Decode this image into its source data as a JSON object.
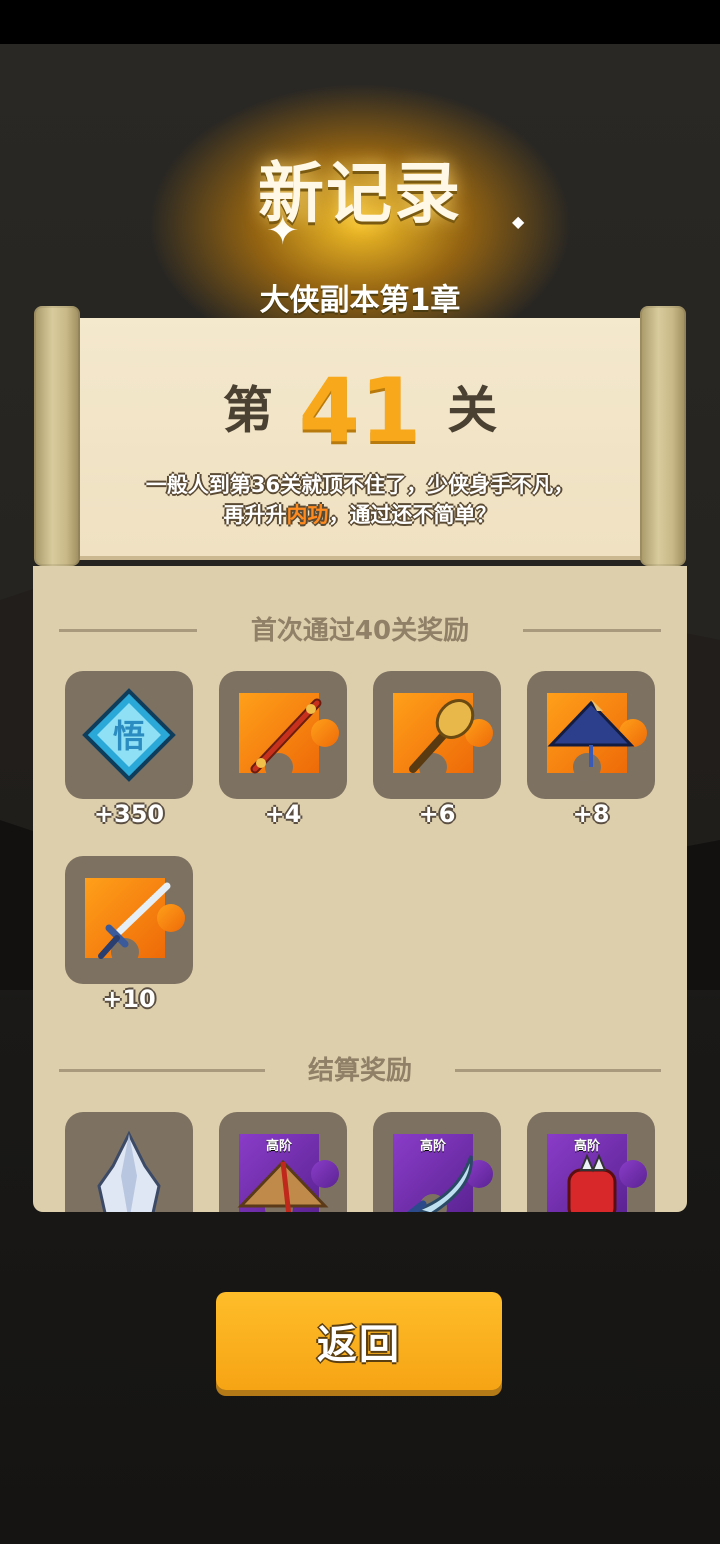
{
  "header": {
    "record_title": "新记录",
    "chapter_title": "大侠副本第1章"
  },
  "stage": {
    "prefix": "第",
    "number": "41",
    "suffix": "关",
    "description_line1": "一般人到第36关就顶不住了，少侠身手不凡，",
    "description_line2_before": "再升升",
    "description_line2_highlight": "内功",
    "description_line2_after": "，通过还不简单？"
  },
  "first_clear_rewards": {
    "title": "首次通过40关奖励",
    "items": [
      {
        "icon": "wu-insight-gem-icon",
        "count": "+350"
      },
      {
        "icon": "staff-fragment-icon",
        "count": "+4"
      },
      {
        "icon": "mace-fragment-icon",
        "count": "+6"
      },
      {
        "icon": "straw-hat-fragment-icon",
        "count": "+8"
      },
      {
        "icon": "sword-fragment-icon",
        "count": "+10"
      }
    ]
  },
  "settlement_rewards": {
    "title": "结算奖励",
    "items": [
      {
        "icon": "crystal-icon",
        "badge": ""
      },
      {
        "icon": "bamboo-hat-fragment-icon",
        "badge": "高阶"
      },
      {
        "icon": "saber-fragment-icon",
        "badge": "高阶"
      },
      {
        "icon": "glove-fragment-icon",
        "badge": "高阶"
      }
    ]
  },
  "footer": {
    "return_label": "返回"
  },
  "colors": {
    "accent_orange": "#f7a81b",
    "highlight": "#ff8a1e",
    "panel": "#ddcfab",
    "button": "#f6a414"
  }
}
